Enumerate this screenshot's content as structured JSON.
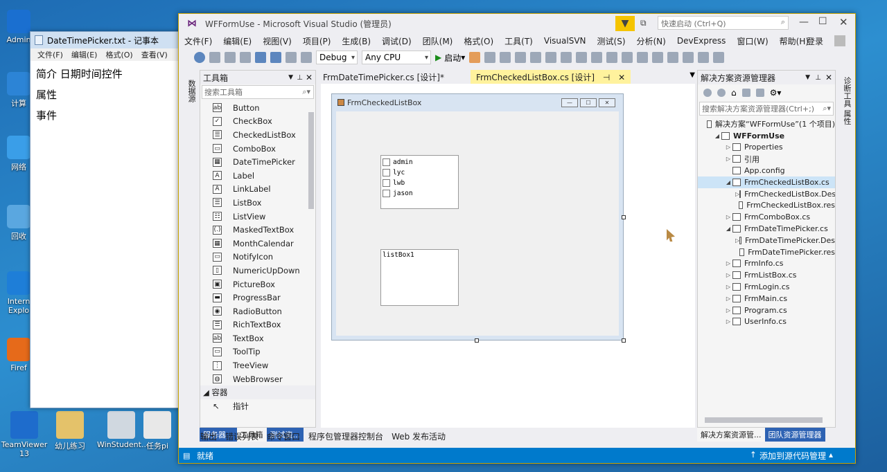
{
  "desktop": {
    "icons_left": [
      {
        "label": "Admin",
        "color": "#1a6fd0"
      },
      {
        "label": "计算",
        "color": "#2c84d6"
      },
      {
        "label": "网络",
        "color": "#3a9ee8"
      },
      {
        "label": "回收",
        "color": "#5aa7e0"
      },
      {
        "label": "Intern\nExplo",
        "color": "#1e7ed8"
      },
      {
        "label": "Firef",
        "color": "#e66a1a"
      }
    ],
    "icons_bottom": [
      {
        "label": "TeamViewer 13",
        "color": "#1e6ccc"
      },
      {
        "label": "幼儿练习",
        "color": "#e4c26a"
      },
      {
        "label": "WinStudent...",
        "color": "#d0d8e0"
      },
      {
        "label": "任务pi",
        "color": "#e8e8e8"
      }
    ]
  },
  "notepad": {
    "title": "DateTimePicker.txt - 记事本",
    "menu": [
      "文件(F)",
      "编辑(E)",
      "格式(O)",
      "查看(V)"
    ],
    "lines": [
      "简介  日期时间控件",
      "属性",
      "事件"
    ]
  },
  "vs": {
    "title": "WFFormUse - Microsoft Visual Studio (管理员)",
    "quick_launch": "快速启动 (Ctrl+Q)",
    "menu": [
      "文件(F)",
      "编辑(E)",
      "视图(V)",
      "项目(P)",
      "生成(B)",
      "调试(D)",
      "团队(M)",
      "格式(O)",
      "工具(T)",
      "VisualSVN",
      "测试(S)",
      "分析(N)",
      "DevExpress",
      "窗口(W)",
      "帮助(H)"
    ],
    "login": "登录",
    "config": "Debug",
    "platform": "Any CPU",
    "start": "启动",
    "left_strip": "数据源",
    "right_strip": "诊断工具  属性",
    "toolbox": {
      "header": "工具箱",
      "search_placeholder": "搜索工具箱",
      "items": [
        "Button",
        "CheckBox",
        "CheckedListBox",
        "ComboBox",
        "DateTimePicker",
        "Label",
        "LinkLabel",
        "ListBox",
        "ListView",
        "MaskedTextBox",
        "MonthCalendar",
        "NotifyIcon",
        "NumericUpDown",
        "PictureBox",
        "ProgressBar",
        "RadioButton",
        "RichTextBox",
        "TextBox",
        "ToolTip",
        "TreeView",
        "WebBrowser"
      ],
      "group": "◢ 容器",
      "pointer": "指针",
      "tabs": [
        "服务器...",
        "工具箱",
        "测试资..."
      ]
    },
    "doc_tabs": [
      "FrmDateTimePicker.cs [设计]*",
      "FrmCheckedListBox.cs [设计]"
    ],
    "designer": {
      "form_title": "FrmCheckedListBox",
      "checked_items": [
        "admin",
        "lyc",
        "lwb",
        "jason"
      ],
      "listbox_text": "listBox1"
    },
    "solution": {
      "header": "解决方案资源管理器",
      "search_placeholder": "搜索解决方案资源管理器(Ctrl+;)",
      "nodes": [
        {
          "indent": 0,
          "arrow": "",
          "label": "解决方案“WFFormUse”(1 个项目)"
        },
        {
          "indent": 1,
          "arrow": "◢",
          "label": "WFFormUse",
          "bold": true
        },
        {
          "indent": 2,
          "arrow": "▷",
          "label": "Properties"
        },
        {
          "indent": 2,
          "arrow": "▷",
          "label": "引用"
        },
        {
          "indent": 2,
          "arrow": "",
          "label": "App.config"
        },
        {
          "indent": 2,
          "arrow": "◢",
          "label": "FrmCheckedListBox.cs",
          "sel": true
        },
        {
          "indent": 3,
          "arrow": "▷",
          "label": "FrmCheckedListBox.Des"
        },
        {
          "indent": 3,
          "arrow": "",
          "label": "FrmCheckedListBox.res"
        },
        {
          "indent": 2,
          "arrow": "▷",
          "label": "FrmComboBox.cs"
        },
        {
          "indent": 2,
          "arrow": "◢",
          "label": "FrmDateTimePicker.cs"
        },
        {
          "indent": 3,
          "arrow": "▷",
          "label": "FrmDateTimePicker.Des"
        },
        {
          "indent": 3,
          "arrow": "",
          "label": "FrmDateTimePicker.res"
        },
        {
          "indent": 2,
          "arrow": "▷",
          "label": "FrmInfo.cs"
        },
        {
          "indent": 2,
          "arrow": "▷",
          "label": "FrmListBox.cs"
        },
        {
          "indent": 2,
          "arrow": "▷",
          "label": "FrmLogin.cs"
        },
        {
          "indent": 2,
          "arrow": "▷",
          "label": "FrmMain.cs"
        },
        {
          "indent": 2,
          "arrow": "▷",
          "label": "Program.cs"
        },
        {
          "indent": 2,
          "arrow": "▷",
          "label": "UserInfo.cs"
        }
      ],
      "tabs": [
        "解决方案资源管...",
        "团队资源管理器"
      ]
    },
    "bottom_tabs": [
      "输出",
      "错误列表",
      "命令窗口",
      "程序包管理器控制台",
      "Web 发布活动"
    ],
    "status": {
      "left": "就绪",
      "right": "添加到源代码管理"
    },
    "accent": "#007acc"
  }
}
